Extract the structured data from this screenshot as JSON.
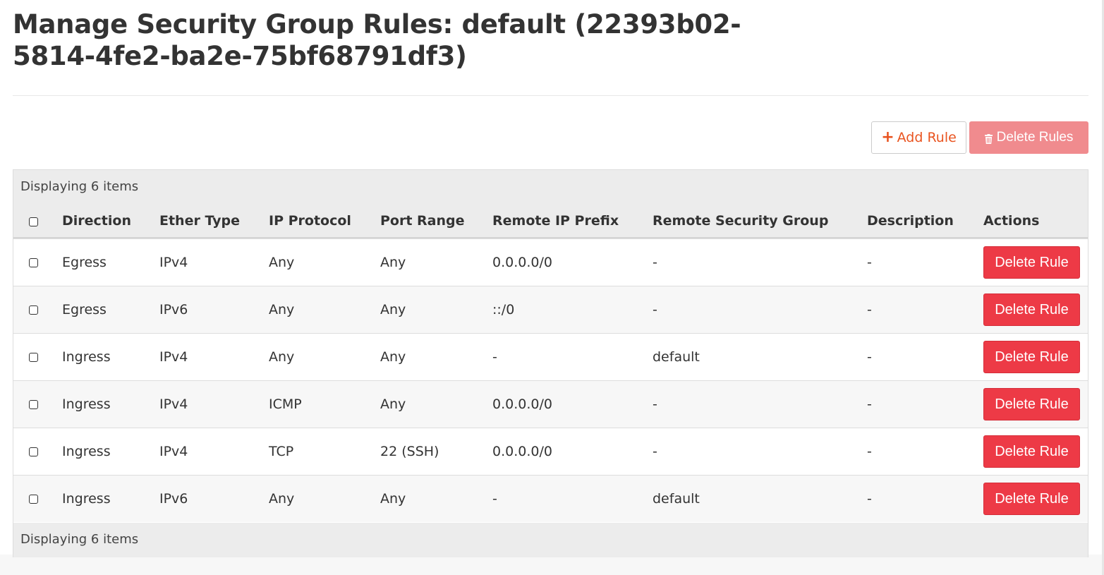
{
  "page": {
    "title": "Manage Security Group Rules: default (22393b02-5814-4fe2-ba2e-75bf68791df3)"
  },
  "toolbar": {
    "add_rule_label": "Add Rule",
    "delete_rules_label": "Delete Rules"
  },
  "table": {
    "caption_top": "Displaying 6 items",
    "caption_bottom": "Displaying 6 items",
    "columns": {
      "direction": "Direction",
      "ether_type": "Ether Type",
      "ip_protocol": "IP Protocol",
      "port_range": "Port Range",
      "remote_ip_prefix": "Remote IP Prefix",
      "remote_security_group": "Remote Security Group",
      "description": "Description",
      "actions": "Actions"
    },
    "rows": [
      {
        "direction": "Egress",
        "ether_type": "IPv4",
        "ip_protocol": "Any",
        "port_range": "Any",
        "remote_ip_prefix": "0.0.0.0/0",
        "remote_security_group": "-",
        "description": "-",
        "action_label": "Delete Rule"
      },
      {
        "direction": "Egress",
        "ether_type": "IPv6",
        "ip_protocol": "Any",
        "port_range": "Any",
        "remote_ip_prefix": "::/0",
        "remote_security_group": "-",
        "description": "-",
        "action_label": "Delete Rule"
      },
      {
        "direction": "Ingress",
        "ether_type": "IPv4",
        "ip_protocol": "Any",
        "port_range": "Any",
        "remote_ip_prefix": "-",
        "remote_security_group": "default",
        "description": "-",
        "action_label": "Delete Rule"
      },
      {
        "direction": "Ingress",
        "ether_type": "IPv4",
        "ip_protocol": "ICMP",
        "port_range": "Any",
        "remote_ip_prefix": "0.0.0.0/0",
        "remote_security_group": "-",
        "description": "-",
        "action_label": "Delete Rule"
      },
      {
        "direction": "Ingress",
        "ether_type": "IPv4",
        "ip_protocol": "TCP",
        "port_range": "22 (SSH)",
        "remote_ip_prefix": "0.0.0.0/0",
        "remote_security_group": "-",
        "description": "-",
        "action_label": "Delete Rule"
      },
      {
        "direction": "Ingress",
        "ether_type": "IPv6",
        "ip_protocol": "Any",
        "port_range": "Any",
        "remote_ip_prefix": "-",
        "remote_security_group": "default",
        "description": "-",
        "action_label": "Delete Rule"
      }
    ]
  },
  "colors": {
    "accent": "#e95420",
    "danger": "#ed3a46",
    "danger_disabled": "#f08b8e"
  },
  "icons": {
    "add": "plus-icon",
    "delete": "trash-icon"
  }
}
